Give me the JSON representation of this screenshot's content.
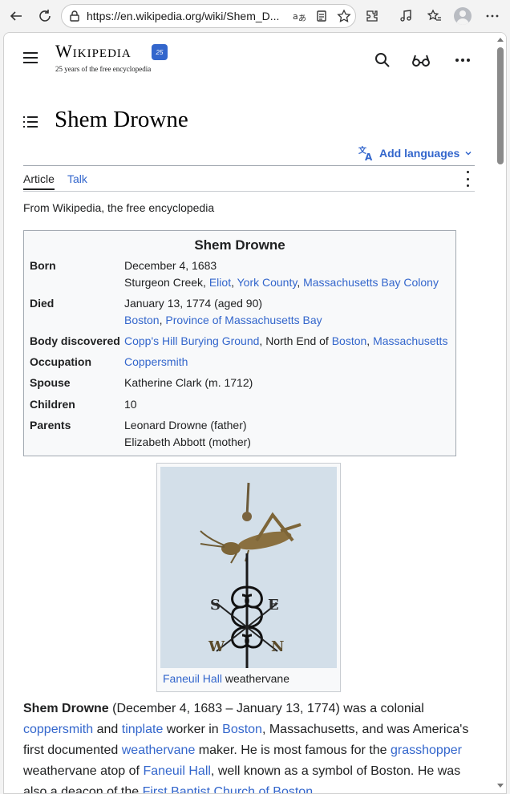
{
  "browser": {
    "url": "https://en.wikipedia.org/wiki/Shem_D..."
  },
  "header": {
    "wordmark": "Wikipedia",
    "badge": "25",
    "subtitle": "25 years of the free encyclopedia"
  },
  "article": {
    "title": "Shem Drowne",
    "add_languages": "Add languages",
    "tabs": {
      "article": "Article",
      "talk": "Talk"
    },
    "tagline": "From Wikipedia, the free encyclopedia"
  },
  "infobox": {
    "title": "Shem Drowne",
    "born_label": "Born",
    "born_line1": "December 4, 1683",
    "born_prefix": "Sturgeon Creek, ",
    "born_l1": "Eliot",
    "born_l2": "York County",
    "born_l3": "Massachusetts Bay Colony",
    "died_label": "Died",
    "died_line1": "January 13, 1774 (aged 90)",
    "died_l1": "Boston",
    "died_l2": "Province of Massachusetts Bay",
    "body_label": "Body discovered",
    "body_l1": "Copp's Hill Burying Ground",
    "body_text": ", North End of ",
    "body_l2": "Boston",
    "body_l3": "Massachusetts",
    "occupation_label": "Occupation",
    "occupation": "Coppersmith",
    "spouse_label": "Spouse",
    "spouse": "Katherine Clark (m. 1712)",
    "children_label": "Children",
    "children": "10",
    "parents_label": "Parents",
    "parent1": "Leonard Drowne (father)",
    "parent2": "Elizabeth Abbott (mother)"
  },
  "figure": {
    "caption_link": "Faneuil Hall",
    "caption_text": " weathervane"
  },
  "body": {
    "p1_bold": "Shem Drowne",
    "p1_t1": " (December 4, 1683 – January 13, 1774) was a colonial ",
    "p1_l1": "coppersmith",
    "p1_t2": " and ",
    "p1_l2": "tinplate",
    "p1_t3": " worker in ",
    "p1_l3": "Boston",
    "p1_t4": ", Massachusetts, and was America's first documented ",
    "p1_l4": "weathervane",
    "p1_t5": " maker. He is most famous for the ",
    "p1_l5": "grasshopper",
    "p1_t6": " weathervane atop of ",
    "p1_l6": "Faneuil Hall",
    "p1_t7": ", well known as a symbol of Boston. He was also a deacon of the ",
    "p1_l7": "First Baptist Church of Boston",
    "p1_t8": "."
  }
}
